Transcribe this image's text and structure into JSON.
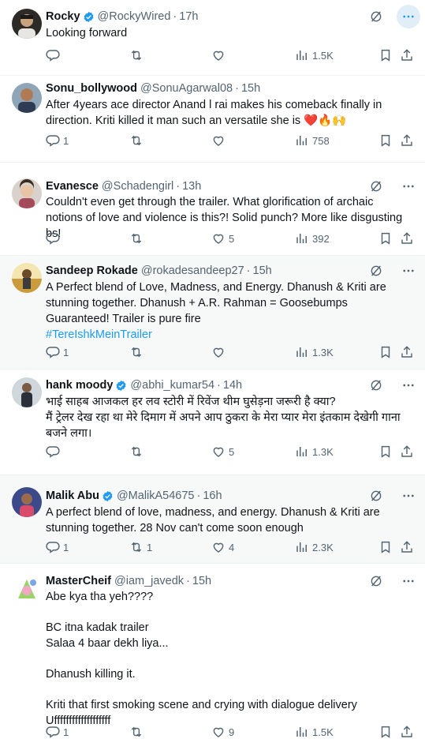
{
  "colors": {
    "accent": "#1d9bf0",
    "text": "#0f1419",
    "muted": "#536471",
    "verified": "#1d9bf0",
    "heart": "#e0245e"
  },
  "icons": {
    "reply": "reply-icon",
    "retweet": "retweet-icon",
    "like": "like-icon",
    "views": "views-icon",
    "bookmark": "bookmark-icon",
    "share": "share-icon",
    "grok": "grok-icon",
    "more": "more-icon",
    "verified": "verified-badge-icon"
  },
  "tweets": [
    {
      "name": "Rocky",
      "handle": "@RockyWired",
      "time": "17h",
      "text": "Looking forward",
      "hashtag": "",
      "replies": "",
      "retweets": "",
      "likes": "",
      "views": "1.5K"
    },
    {
      "name": "Sonu_bollywood",
      "handle": "@SonuAgarwal08",
      "time": "15h",
      "text": "After 4years ace director Anand l rai makes his comeback finally in direction. Kriti killed it man such an versatile she is ❤️🔥🙌",
      "hashtag": "",
      "replies": "1",
      "retweets": "",
      "likes": "",
      "views": "758"
    },
    {
      "name": "Evanesce",
      "handle": "@Schadengirl",
      "time": "13h",
      "text": "Couldn't even get through the trailer. What glorification of archaic notions of love and violence is this?! Solid punch? More like disgusting bs!",
      "hashtag": "",
      "replies": "",
      "retweets": "",
      "likes": "5",
      "views": "392"
    },
    {
      "name": "Sandeep Rokade",
      "handle": "@rokadesandeep27",
      "time": "15h",
      "text": "A Perfect blend of Love, Madness, and Energy. Dhanush & Kriti are stunning together. Dhanush + A.R. Rahman = Goosebumps Guaranteed! Trailer is pure fire",
      "hashtag": "#TereIshkMeinTrailer",
      "replies": "1",
      "retweets": "",
      "likes": "",
      "views": "1.3K"
    },
    {
      "name": "hank moody",
      "handle": "@abhi_kumar54",
      "time": "14h",
      "text": "भाई साहब आजकल हर लव स्टोरी में रिवेंज थीम घुसेड़ना जरूरी है क्या?\nमैं ट्रेलर देख रहा था मेरे दिमाग में अपने आप ठुकरा के मेरा प्यार मेरा इंतकाम देखेगी गाना बजने लगा।",
      "hashtag": "",
      "replies": "",
      "retweets": "",
      "likes": "5",
      "views": "1.3K"
    },
    {
      "name": "Malik Abu",
      "handle": "@MalikA54675",
      "time": "16h",
      "text": "A perfect blend of love, madness, and energy. Dhanush & Kriti are stunning together. 28 Nov can't come soon enough",
      "hashtag": "",
      "replies": "1",
      "retweets": "1",
      "likes": "4",
      "views": "2.3K"
    },
    {
      "name": "MasterCheif",
      "handle": "@iam_javedk",
      "time": "15h",
      "text": "Abe kya tha yeh????\n\nBC itna kadak trailer\nSalaa 4 baar dekh liya...\n\nDhanush killing it.\n\nKriti that first smoking scene and crying with dialogue delivery Ufffffffffffffffffff",
      "hashtag": "",
      "replies": "1",
      "retweets": "",
      "likes": "9",
      "views": "1.5K"
    }
  ]
}
